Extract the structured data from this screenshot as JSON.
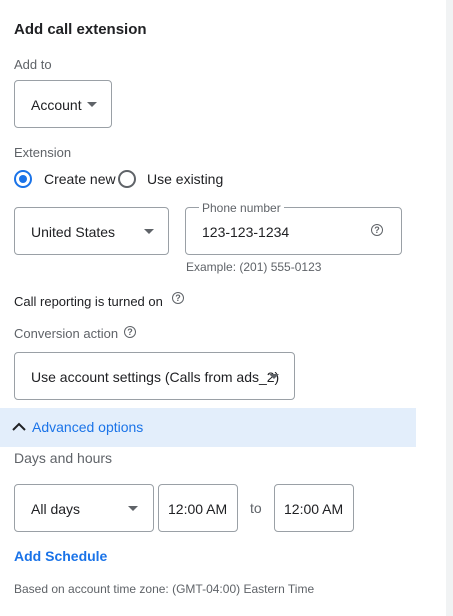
{
  "title": "Add call extension",
  "add_to": {
    "label": "Add to",
    "value": "Account"
  },
  "extension": {
    "label": "Extension",
    "options": [
      {
        "label": "Create new",
        "selected": true
      },
      {
        "label": "Use existing",
        "selected": false
      }
    ]
  },
  "country": {
    "value": "United States"
  },
  "phone": {
    "label": "Phone number",
    "value": "123-123-1234",
    "example": "Example: (201) 555-0123"
  },
  "call_reporting": {
    "text": "Call reporting is turned on"
  },
  "conversion": {
    "label": "Conversion action",
    "value": "Use account settings (Calls from ads_2)"
  },
  "advanced": {
    "label": "Advanced options",
    "expanded": true
  },
  "days_hours": {
    "label": "Days and hours",
    "day_value": "All days",
    "start_time": "12:00 AM",
    "to_label": "to",
    "end_time": "12:00 AM"
  },
  "add_schedule": "Add Schedule",
  "timezone_note": "Based on account time zone: (GMT-04:00) Eastern Time",
  "icons": {
    "help": "help-circle-icon",
    "dropdown": "caret-down-icon",
    "chevron": "chevron-up-icon"
  },
  "colors": {
    "accent": "#1a73e8",
    "highlight": "#e3eefb"
  }
}
